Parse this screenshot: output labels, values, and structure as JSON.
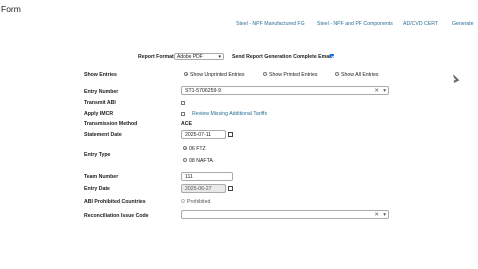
{
  "page": {
    "title": "Form"
  },
  "nav": {
    "link1": "Steel - NPF Manufactured FG",
    "link2": "Steel - NPF and PF Components",
    "link3": "AD/CVD CERT",
    "link4": "Generate"
  },
  "report": {
    "format_label": "Report Format",
    "format_value": "Adobe PDF",
    "email_label": "Send Report Generation Complete Email",
    "email_checked": true
  },
  "show_entries": {
    "label": "Show Entries",
    "options": [
      "Show Unprinted Entries",
      "Show Printed Entries",
      "Show All Entries"
    ],
    "selected": "Show Unprinted Entries"
  },
  "entry_number": {
    "label": "Entry Number",
    "value": "ST1-5706259-9",
    "clear_glyph": "✕",
    "arrow_glyph": "▾"
  },
  "transmit_abi": {
    "label": "Transmit ABI",
    "checked": false
  },
  "apply_imcr": {
    "label": "Apply IMCR",
    "link": "Review Missing Additional Tariffs",
    "checked": false
  },
  "transmission_method": {
    "label": "Transmission Method",
    "value": "ACE"
  },
  "statement_date": {
    "label": "Statement Date",
    "value": "2025-07-11"
  },
  "entry_type": {
    "label": "Entry Type",
    "options": [
      "06 FTZ",
      "08 NAFTA"
    ],
    "selected": "06 FTZ"
  },
  "team_number": {
    "label": "Team Number",
    "value": "111"
  },
  "entry_date": {
    "label": "Entry Date",
    "value": "2025-06-27"
  },
  "abi_prohibited": {
    "label": "ABI Prohibited Countries",
    "option": "Prohibited"
  },
  "reconciliation": {
    "label": "Reconciliation Issue Code",
    "value": "",
    "clear_glyph": "✕",
    "arrow_glyph": "▾"
  },
  "icons": {
    "calendar": "calendar-icon",
    "cursor": "mouse-cursor-icon"
  },
  "colors": {
    "link": "#2a6f97",
    "accent": "#1a73e8"
  }
}
